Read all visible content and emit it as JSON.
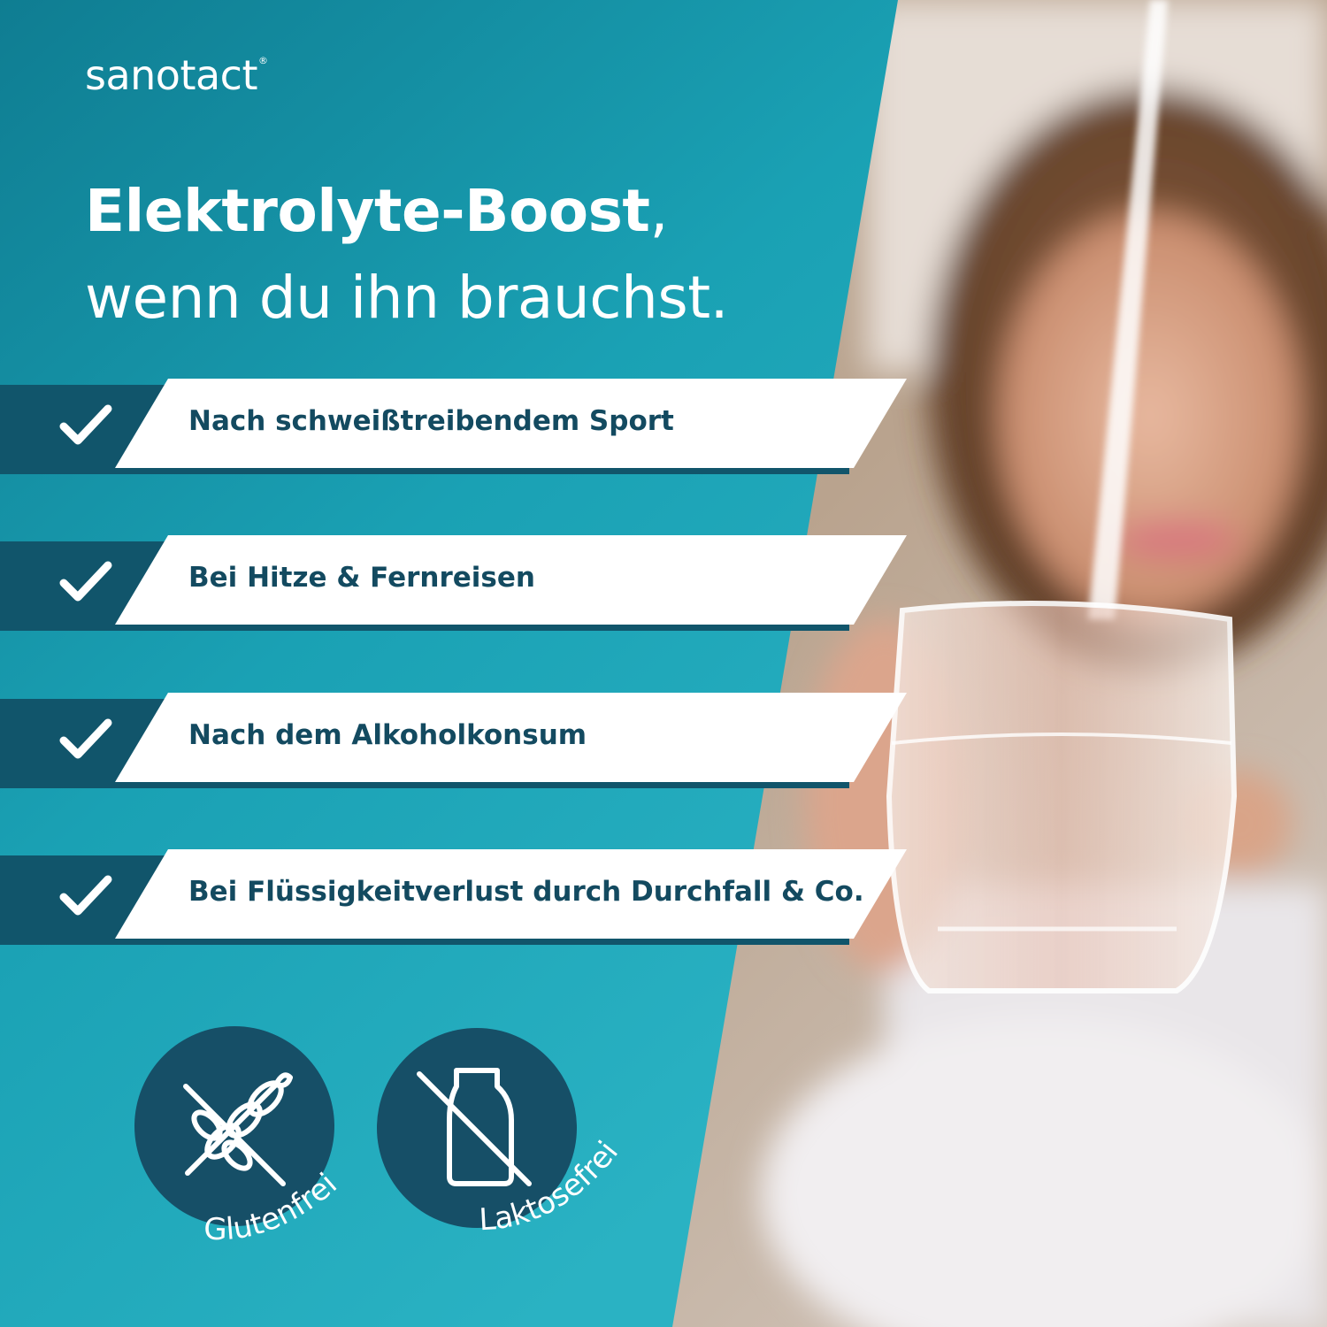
{
  "brand": {
    "name": "sanotact",
    "reg": "®"
  },
  "headline": {
    "bold": "Elektrolyte-Boost",
    "comma": ",",
    "line2": "wenn du ihn brauchst."
  },
  "benefits": [
    {
      "label": "Nach schweißtreibendem Sport",
      "icon": "check-icon"
    },
    {
      "label": "Bei Hitze & Fernreisen",
      "icon": "check-icon"
    },
    {
      "label": "Nach dem Alkoholkonsum",
      "icon": "check-icon"
    },
    {
      "label": "Bei Flüssigkeitverlust durch Durchfall & Co.",
      "icon": "check-icon"
    }
  ],
  "badges": [
    {
      "label": "Glutenfrei",
      "icon": "gluten-free-icon"
    },
    {
      "label": "Laktosefrei",
      "icon": "lactose-free-icon"
    }
  ],
  "colors": {
    "teal": "#1aa0b3",
    "navy": "#11556b",
    "text_dark": "#134a60",
    "white": "#ffffff"
  }
}
